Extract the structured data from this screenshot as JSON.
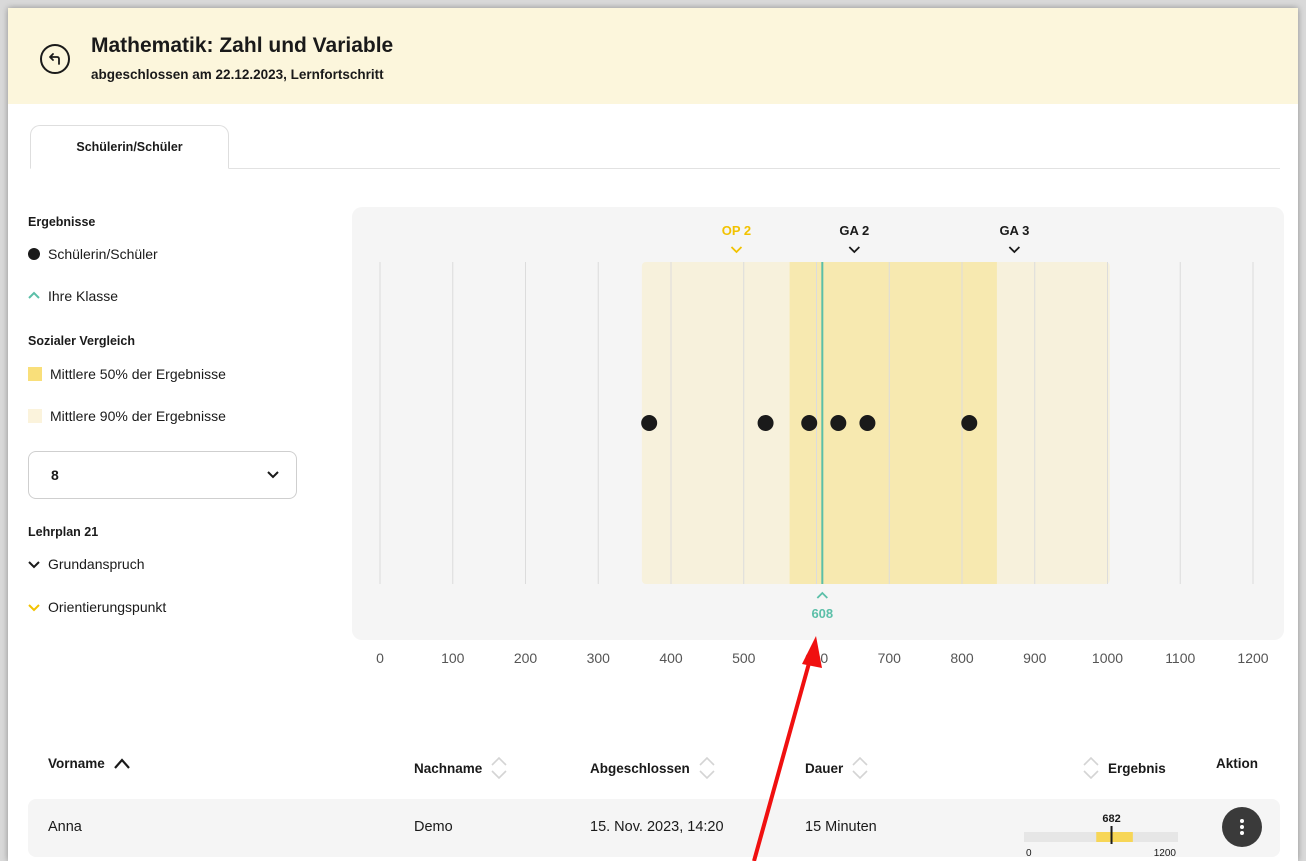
{
  "header": {
    "title": "Mathematik: Zahl und Variable",
    "subtitle": "abgeschlossen am 22.12.2023, Lernfortschritt",
    "back_icon": "back-arrow-icon"
  },
  "tabs": [
    {
      "label": "Schülerin/Schüler",
      "active": true
    }
  ],
  "legend": {
    "results_heading": "Ergebnisse",
    "student_label": "Schülerin/Schüler",
    "class_label": "Ihre Klasse",
    "social_heading": "Sozialer Vergleich",
    "middle50_label": "Mittlere 50% der Ergebnisse",
    "middle90_label": "Mittlere 90% der Ergebnisse",
    "grade_select": {
      "value": "8"
    },
    "curriculum_heading": "Lehrplan 21",
    "grundanspruch_label": "Grundanspruch",
    "orientierungspunkt_label": "Orientierungspunkt"
  },
  "colors": {
    "accent_yellow": "#f2c200",
    "band50": "#f7e9b0",
    "band90": "#f7f1dc",
    "class_line": "#5bbfa8",
    "student_dot": "#1a1a1a",
    "header_bg": "#fcf6dc",
    "annotation_arrow": "#f01010"
  },
  "chart_data": {
    "type": "scatter",
    "x_ticks": [
      0,
      100,
      200,
      300,
      400,
      500,
      600,
      700,
      800,
      900,
      1000,
      1100,
      1200
    ],
    "x_tick_labels": [
      "0",
      "100",
      "200",
      "300",
      "400",
      "500",
      "600",
      "700",
      "800",
      "900",
      "1000",
      "1100",
      "1200"
    ],
    "xlim": [
      0,
      1200
    ],
    "student_results": [
      370,
      530,
      590,
      630,
      670,
      810
    ],
    "class_marker": {
      "value": 608,
      "label": "608"
    },
    "middle50_range": [
      563,
      848
    ],
    "middle90_range": [
      360,
      1003
    ],
    "markers": [
      {
        "label": "OP 2",
        "value": 490,
        "kind": "orientierungspunkt"
      },
      {
        "label": "GA 2",
        "value": 652,
        "kind": "grundanspruch"
      },
      {
        "label": "GA 3",
        "value": 872,
        "kind": "grundanspruch"
      }
    ],
    "grid": true
  },
  "table": {
    "headers": {
      "vorname": "Vorname",
      "nachname": "Nachname",
      "abgeschlossen": "Abgeschlossen",
      "dauer": "Dauer",
      "ergebnis": "Ergebnis",
      "aktion": "Aktion"
    },
    "rows": [
      {
        "vorname": "Anna",
        "nachname": "Demo",
        "abgeschlossen": "15. Nov. 2023, 14:20",
        "dauer": "15 Minuten",
        "ergebnis": 682,
        "ergebnis_label": "682",
        "mini_min": "0",
        "mini_max": "1200",
        "action_icon": "more-vertical-icon"
      }
    ]
  }
}
